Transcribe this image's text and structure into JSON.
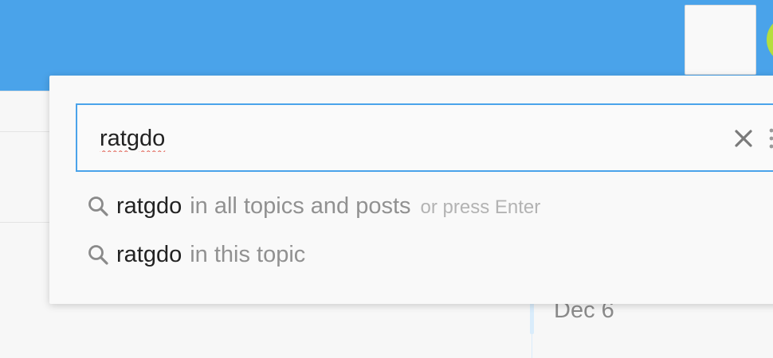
{
  "search": {
    "query": "ratgdo",
    "clear_icon": "close-icon",
    "more_icon": "more-vertical-icon"
  },
  "suggestions": [
    {
      "icon": "search-icon",
      "term": "ratgdo",
      "scope": "in all topics and posts",
      "hint": "or press Enter"
    },
    {
      "icon": "search-icon",
      "term": "ratgdo",
      "scope": "in this topic",
      "hint": ""
    }
  ],
  "timeline": {
    "date": "Dec 6"
  },
  "colors": {
    "header": "#4aa3ea",
    "accent_border": "#4aa3ea",
    "avatar": "#b5de3e"
  }
}
